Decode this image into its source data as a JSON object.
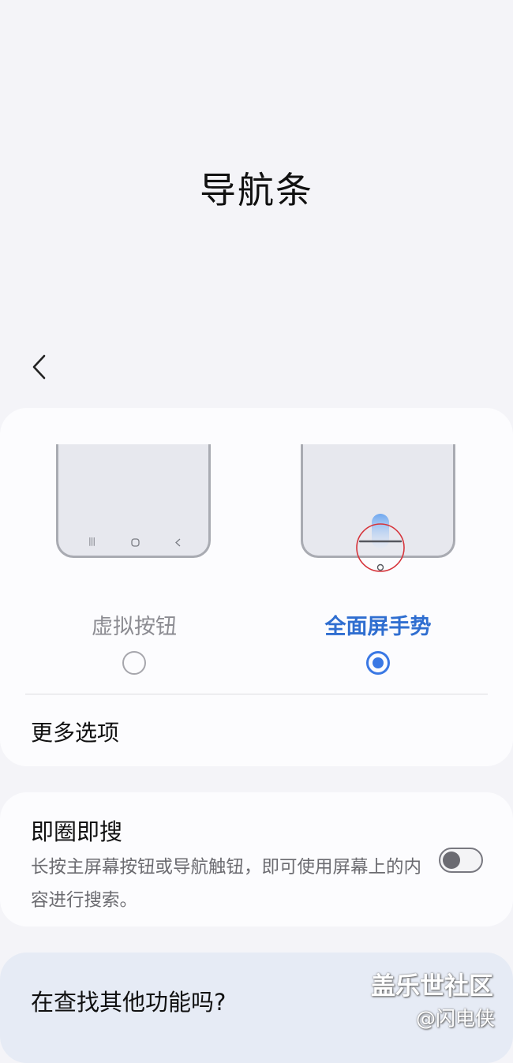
{
  "header": {
    "title": "导航条"
  },
  "nav_options": {
    "buttons": {
      "label": "虚拟按钮",
      "selected": false
    },
    "gesture": {
      "label": "全面屏手势",
      "selected": true
    }
  },
  "more_options": {
    "label": "更多选项"
  },
  "circle_to_search": {
    "title": "即圈即搜",
    "description": "长按主屏幕按钮或导航触钮，即可使用屏幕上的内容进行搜索。",
    "enabled": false
  },
  "footer": {
    "question": "在查找其他功能吗?"
  },
  "watermark": {
    "brand": "盖乐世社区",
    "user": "@闪电侠"
  },
  "colors": {
    "accent": "#3a78e4",
    "highlight_ring": "#d6343b"
  },
  "icons": {
    "back": "chevron-left-icon",
    "recents": "recents-icon",
    "home": "home-icon",
    "back_nav": "back-nav-icon"
  }
}
